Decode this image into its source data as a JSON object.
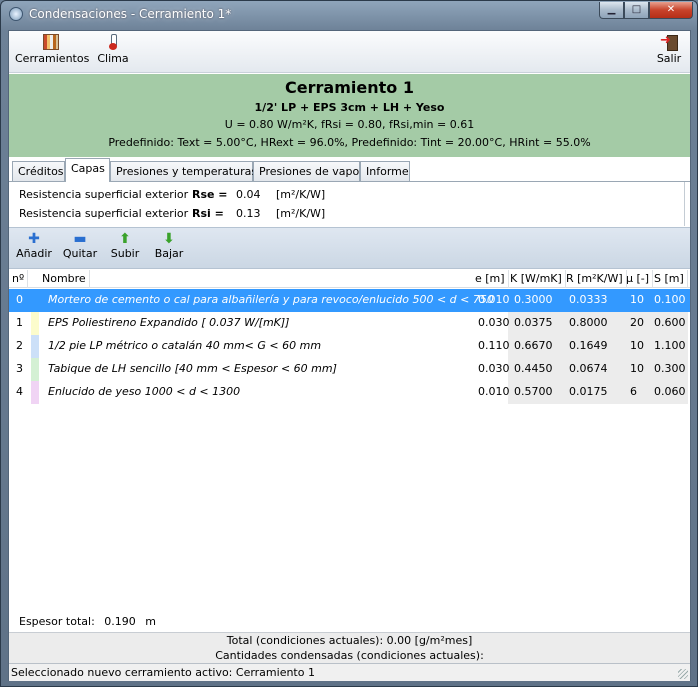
{
  "window": {
    "title": "Condensaciones - Cerramiento 1*"
  },
  "toolbar": {
    "cerramientos_label": "Cerramientos",
    "clima_label": "Clima",
    "salir_label": "Salir"
  },
  "header": {
    "title": "Cerramiento 1",
    "subtitle": "1/2' LP + EPS 3cm + LH + Yeso",
    "u_line": "U = 0.80 W/m²K, fRsi = 0.80, fRsi,min = 0.61",
    "predef_line": "Predefinido: Text = 5.00°C, HRext = 96.0%, Predefinido: Tint = 20.00°C, HRint = 55.0%",
    "background": "#a4cba6"
  },
  "tabs": [
    {
      "label": "Créditos",
      "active": false
    },
    {
      "label": "Capas",
      "active": true
    },
    {
      "label": "Presiones y temperaturas",
      "active": false
    },
    {
      "label": "Presiones de vapor",
      "active": false
    },
    {
      "label": "Informe",
      "active": false
    }
  ],
  "surface_resistance": [
    {
      "label": "Resistencia superficial exterior",
      "key": "Rse =",
      "value": "0.04",
      "unit": "[m²/K/W]"
    },
    {
      "label": "Resistencia superficial exterior",
      "key": "Rsi =",
      "value": "0.13",
      "unit": "[m²/K/W]"
    }
  ],
  "layer_toolbar": {
    "add_label": "Añadir",
    "remove_label": "Quitar",
    "up_label": "Subir",
    "down_label": "Bajar"
  },
  "table": {
    "headers": {
      "n": "nº",
      "name": "Nombre",
      "e": "e [m]",
      "k": "K [W/mK]",
      "r": "R [m²K/W]",
      "mu": "µ [-]",
      "s": "S [m]"
    },
    "rows": [
      {
        "n": "0",
        "name": "Mortero de cemento o cal para albañilería y para revoco/enlucido 500 < d < 750",
        "e": "0.010",
        "k": "0.3000",
        "r": "0.0333",
        "mu": "10",
        "s": "0.100",
        "color": "#3399ff",
        "selected": true
      },
      {
        "n": "1",
        "name": "EPS Poliestireno Expandido [ 0.037 W/[mK]]",
        "e": "0.030",
        "k": "0.0375",
        "r": "0.8000",
        "mu": "20",
        "s": "0.600",
        "color": "#fcfccc",
        "selected": false
      },
      {
        "n": "2",
        "name": "1/2 pie LP métrico o catalán 40 mm< G < 60 mm",
        "e": "0.110",
        "k": "0.6670",
        "r": "0.1649",
        "mu": "10",
        "s": "1.100",
        "color": "#cce0f8",
        "selected": false
      },
      {
        "n": "3",
        "name": "Tabique de LH sencillo [40 mm < Espesor < 60 mm]",
        "e": "0.030",
        "k": "0.4450",
        "r": "0.0674",
        "mu": "10",
        "s": "0.300",
        "color": "#d4f0d4",
        "selected": false
      },
      {
        "n": "4",
        "name": "Enlucido de yeso 1000 < d < 1300",
        "e": "0.010",
        "k": "0.5700",
        "r": "0.0175",
        "mu": "6",
        "s": "0.060",
        "color": "#f0d4f4",
        "selected": false
      }
    ]
  },
  "espesor": {
    "label": "Espesor total:",
    "value": "0.190",
    "unit": "m"
  },
  "summary": {
    "total": "Total (condiciones actuales): 0.00 [g/m²mes]",
    "condensadas": "Cantidades condensadas (condiciones actuales):"
  },
  "status": "Seleccionado nuevo cerramiento activo: Cerramiento 1"
}
